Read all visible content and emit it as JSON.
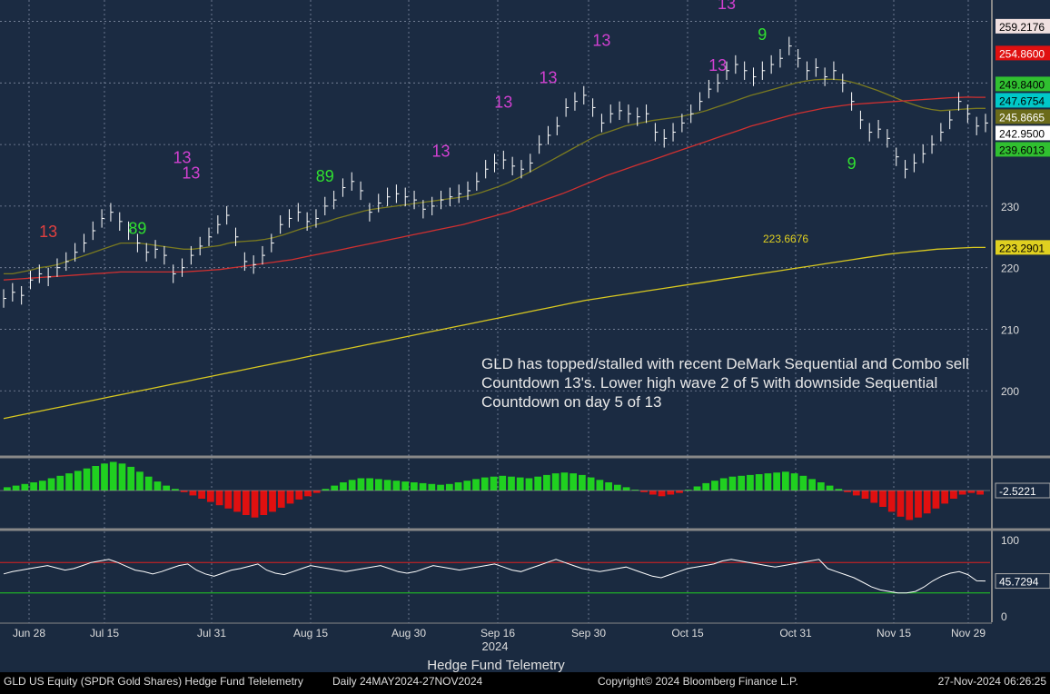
{
  "chart_data": {
    "type": "line",
    "title": "GLD US Equity (SPDR Gold Shares) Hedge Fund Telelemetry",
    "period": "Daily 24MAY2024-27NOV2024",
    "footer_center": "Hedge Fund Telemetry",
    "copyright": "Copyright© 2024 Bloomberg Finance L.P.",
    "timestamp": "27-Nov-2024 06:26:25",
    "year_label": "2024",
    "annotation": "GLD has topped/stalled with recent DeMark Sequential and Combo sell Countdown 13's.  Lower high wave 2 of 5 with downside Sequential Countdown on day 5 of 13",
    "x_ticks": [
      "Jun 28",
      "Jul 15",
      "Jul 31",
      "Aug 15",
      "Aug 30",
      "Sep 16",
      "Sep 30",
      "Oct 15",
      "Oct 31",
      "Nov 15",
      "Nov 29"
    ],
    "price_axis": {
      "ylim": [
        190,
        262
      ],
      "ticks": [
        200,
        210,
        220,
        230
      ]
    },
    "price_labels": [
      {
        "value": 259.2176,
        "text": "259.2176",
        "bg": "#f0e0e0",
        "fg": "#000000"
      },
      {
        "value": 254.86,
        "text": "254.8600",
        "bg": "#e01010",
        "fg": "#ffffff"
      },
      {
        "value": 249.84,
        "text": "249.8400",
        "bg": "#30c030",
        "fg": "#000000"
      },
      {
        "value": 247.6754,
        "text": "247.6754",
        "bg": "#00c8c8",
        "fg": "#000000"
      },
      {
        "value": 245.8665,
        "text": "245.8665",
        "bg": "#6b6b1a",
        "fg": "#ffffff"
      },
      {
        "value": 242.95,
        "text": "242.9500",
        "bg": "#ffffff",
        "fg": "#000000"
      },
      {
        "value": 239.6013,
        "text": "239.6013",
        "bg": "#30c030",
        "fg": "#000000"
      },
      {
        "value": 223.2901,
        "text": "223.2901",
        "bg": "#e0d020",
        "fg": "#000000"
      }
    ],
    "level_label": {
      "value": 223.6676,
      "text": "223.6676"
    },
    "series": [
      {
        "name": "GLD close",
        "color": "#ffffff",
        "values": [
          215,
          216,
          215.5,
          218,
          219,
          218.5,
          220,
          221,
          222.5,
          224,
          226,
          228,
          229,
          227.5,
          226,
          224,
          222.5,
          223,
          222,
          219,
          220,
          222,
          223.5,
          225,
          227,
          228.5,
          225,
          221,
          220.5,
          222,
          224,
          227,
          228,
          229,
          227.5,
          228,
          230,
          231,
          233,
          234,
          232.5,
          229,
          230.5,
          231.5,
          232,
          231.5,
          231,
          229.5,
          230,
          231,
          231.5,
          232,
          232.5,
          234,
          236,
          237,
          237.5,
          236.5,
          236,
          237,
          240,
          241.5,
          243,
          246,
          247,
          248,
          246,
          243.5,
          245,
          245.5,
          245,
          244.5,
          245,
          242,
          241,
          242,
          243.5,
          245,
          247,
          249,
          250,
          252,
          253,
          252,
          251,
          252,
          253,
          254,
          256,
          254,
          252,
          252.5,
          251,
          252,
          250,
          247,
          244,
          242,
          242.5,
          241,
          238,
          236,
          237,
          238.5,
          240,
          242,
          244,
          247,
          245,
          243,
          243.5
        ]
      },
      {
        "name": "MA short",
        "color": "#7a7a20",
        "values": [
          219,
          219,
          219.3,
          219.6,
          220,
          220.2,
          220.5,
          221,
          221.5,
          222,
          222.5,
          223,
          223.5,
          224,
          224,
          224,
          223.8,
          223.6,
          223.4,
          223.2,
          223,
          223,
          223.2,
          223.4,
          223.6,
          224,
          224.2,
          224.3,
          224.4,
          224.6,
          224.9,
          225.3,
          225.8,
          226.3,
          226.7,
          227.1,
          227.5,
          228,
          228.4,
          228.8,
          229.2,
          229.5,
          229.7,
          229.9,
          230.1,
          230.3,
          230.5,
          230.7,
          230.9,
          231.1,
          231.3,
          231.5,
          231.8,
          232.2,
          232.7,
          233.2,
          233.8,
          234.5,
          235.2,
          236,
          236.8,
          237.6,
          238.4,
          239.2,
          240,
          240.8,
          241.5,
          242,
          242.5,
          243,
          243.3,
          243.6,
          243.9,
          244.1,
          244.3,
          244.5,
          244.8,
          245.1,
          245.5,
          246,
          246.5,
          247,
          247.5,
          248,
          248.4,
          248.8,
          249.2,
          249.6,
          250,
          250.3,
          250.5,
          250.6,
          250.6,
          250.5,
          250.2,
          249.8,
          249.3,
          248.8,
          248.2,
          247.6,
          247,
          246.5,
          246,
          245.7,
          245.5,
          245.6,
          245.7,
          245.8,
          245.87,
          245.87
        ]
      },
      {
        "name": "MA mid",
        "color": "#d03030",
        "values": [
          218,
          218.1,
          218.2,
          218.3,
          218.4,
          218.5,
          218.6,
          218.7,
          218.8,
          218.9,
          219,
          219.1,
          219.2,
          219.3,
          219.3,
          219.3,
          219.3,
          219.3,
          219.3,
          219.3,
          219.3,
          219.4,
          219.5,
          219.6,
          219.7,
          219.9,
          220.1,
          220.3,
          220.5,
          220.7,
          220.9,
          221.1,
          221.3,
          221.6,
          221.9,
          222.2,
          222.5,
          222.8,
          223.1,
          223.4,
          223.7,
          224,
          224.3,
          224.6,
          224.9,
          225.2,
          225.5,
          225.8,
          226.1,
          226.4,
          226.7,
          227,
          227.4,
          227.8,
          228.2,
          228.6,
          229,
          229.5,
          230,
          230.5,
          231,
          231.5,
          232,
          232.6,
          233.2,
          233.8,
          234.4,
          235,
          235.5,
          236,
          236.5,
          237,
          237.5,
          238,
          238.5,
          239,
          239.5,
          240,
          240.5,
          241,
          241.5,
          242,
          242.5,
          243,
          243.4,
          243.8,
          244.2,
          244.6,
          245,
          245.3,
          245.6,
          245.9,
          246.1,
          246.3,
          246.5,
          246.6,
          246.7,
          246.8,
          246.9,
          247,
          247.1,
          247.2,
          247.3,
          247.4,
          247.5,
          247.6,
          247.65,
          247.7,
          247.68,
          247.68
        ]
      },
      {
        "name": "MA long",
        "color": "#d8c820",
        "values": [
          195.5,
          195.9,
          196.3,
          196.7,
          197.1,
          197.5,
          197.9,
          198.3,
          198.7,
          199.1,
          199.5,
          199.9,
          200.3,
          200.7,
          201.1,
          201.5,
          201.9,
          202.3,
          202.7,
          203.1,
          203.5,
          203.9,
          204.3,
          204.7,
          205.1,
          205.5,
          205.9,
          206.3,
          206.7,
          207.1,
          207.5,
          207.9,
          208.3,
          208.7,
          209.1,
          209.5,
          209.9,
          210.3,
          210.7,
          211.1,
          211.5,
          211.9,
          212.3,
          212.7,
          213.1,
          213.5,
          213.9,
          214.3,
          214.7,
          215,
          215.3,
          215.6,
          215.9,
          216.2,
          216.5,
          216.8,
          217.1,
          217.4,
          217.7,
          218,
          218.3,
          218.6,
          218.9,
          219.2,
          219.5,
          219.8,
          220.1,
          220.4,
          220.7,
          221,
          221.3,
          221.6,
          221.9,
          222.2,
          222.4,
          222.6,
          222.8,
          223,
          223.1,
          223.2,
          223.29,
          223.29
        ]
      }
    ],
    "countdown_labels": [
      {
        "text": "13",
        "color": "#d040d0",
        "i": 20,
        "v": 237
      },
      {
        "text": "13",
        "color": "#d040d0",
        "i": 21,
        "v": 234.5
      },
      {
        "text": "13",
        "color": "#d040d0",
        "i": 49,
        "v": 238
      },
      {
        "text": "13",
        "color": "#d040d0",
        "i": 56,
        "v": 246
      },
      {
        "text": "13",
        "color": "#d040d0",
        "i": 61,
        "v": 250
      },
      {
        "text": "13",
        "color": "#d040d0",
        "i": 67,
        "v": 256
      },
      {
        "text": "13",
        "color": "#d040d0",
        "i": 81,
        "v": 262
      },
      {
        "text": "13",
        "color": "#d040d0",
        "i": 80,
        "v": 252
      },
      {
        "text": "13",
        "color": "#e04040",
        "i": 5,
        "v": 225
      },
      {
        "text": "9",
        "color": "#30e030",
        "i": 95,
        "v": 236
      },
      {
        "text": "9",
        "color": "#30e030",
        "i": 85,
        "v": 257
      },
      {
        "text": "89",
        "color": "#30e030",
        "i": 15,
        "v": 225.5
      },
      {
        "text": "89",
        "color": "#30e030",
        "i": 36,
        "v": 234
      }
    ],
    "macd_axis": {
      "label": "-2.5221"
    },
    "macd_values": [
      0.4,
      0.6,
      0.8,
      1,
      1.2,
      1.5,
      1.8,
      2.1,
      2.4,
      2.7,
      3,
      3.3,
      3.5,
      3.3,
      2.9,
      2.3,
      1.7,
      1.1,
      0.6,
      0.2,
      -0.2,
      -0.6,
      -1,
      -1.4,
      -1.8,
      -2.2,
      -2.6,
      -3,
      -3.3,
      -3,
      -2.6,
      -2.1,
      -1.6,
      -1.1,
      -0.7,
      -0.3,
      0.2,
      0.6,
      1,
      1.3,
      1.5,
      1.5,
      1.4,
      1.3,
      1.2,
      1.1,
      1,
      0.9,
      0.8,
      0.7,
      0.8,
      1,
      1.2,
      1.4,
      1.6,
      1.7,
      1.8,
      1.7,
      1.6,
      1.5,
      1.7,
      1.9,
      2.1,
      2.2,
      2.1,
      1.9,
      1.6,
      1.3,
      1,
      0.7,
      0.4,
      0.1,
      -0.2,
      -0.5,
      -0.7,
      -0.5,
      -0.3,
      0.1,
      0.5,
      0.9,
      1.2,
      1.5,
      1.7,
      1.8,
      1.9,
      2,
      2.1,
      2.2,
      2.3,
      2.1,
      1.8,
      1.4,
      1,
      0.6,
      0.2,
      -0.2,
      -0.6,
      -1,
      -1.5,
      -2,
      -2.6,
      -3.2,
      -3.6,
      -3.3,
      -2.8,
      -2.2,
      -1.6,
      -1,
      -0.5,
      -0.3,
      -0.5
    ],
    "rsi_axis": {
      "ticks": [
        0,
        50,
        100
      ],
      "overbought": 70,
      "oversold": 30,
      "label": "45.7294"
    },
    "rsi_values": [
      55,
      58,
      60,
      62,
      64,
      66,
      63,
      60,
      62,
      66,
      70,
      72,
      74,
      70,
      65,
      60,
      58,
      55,
      58,
      62,
      66,
      68,
      60,
      55,
      52,
      56,
      60,
      62,
      65,
      68,
      60,
      56,
      54,
      58,
      62,
      66,
      64,
      62,
      60,
      58,
      60,
      62,
      64,
      66,
      62,
      58,
      56,
      58,
      62,
      66,
      64,
      62,
      60,
      62,
      64,
      66,
      68,
      64,
      60,
      58,
      62,
      66,
      70,
      74,
      70,
      66,
      62,
      60,
      58,
      60,
      62,
      64,
      60,
      56,
      52,
      50,
      54,
      58,
      62,
      64,
      66,
      68,
      72,
      74,
      72,
      70,
      68,
      66,
      64,
      66,
      68,
      70,
      72,
      74,
      62,
      58,
      54,
      50,
      44,
      38,
      34,
      32,
      30,
      30,
      32,
      38,
      46,
      52,
      56,
      58,
      54,
      46,
      45.7
    ]
  }
}
